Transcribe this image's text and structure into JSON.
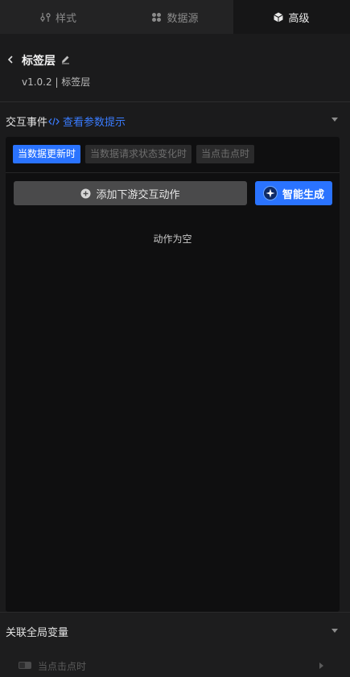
{
  "tabs": [
    {
      "label": "样式",
      "icon": "style-icon"
    },
    {
      "label": "数据源",
      "icon": "datasource-icon"
    },
    {
      "label": "高级",
      "icon": "advanced-icon"
    }
  ],
  "header": {
    "title": "标签层",
    "version_line": "v1.0.2 | 标签层"
  },
  "interaction": {
    "title": "交互事件",
    "hint": "查看参数提示",
    "event_tabs": [
      "当数据更新时",
      "当数据请求状态变化时",
      "当点击点时"
    ],
    "add_action": "添加下游交互动作",
    "ai_generate": "智能生成",
    "empty": "动作为空"
  },
  "global_vars": {
    "title": "关联全局变量",
    "item": "当点击点时"
  },
  "colors": {
    "accent": "#2a73ff",
    "background": "#1b1b1c",
    "panel": "#0f0f10"
  }
}
